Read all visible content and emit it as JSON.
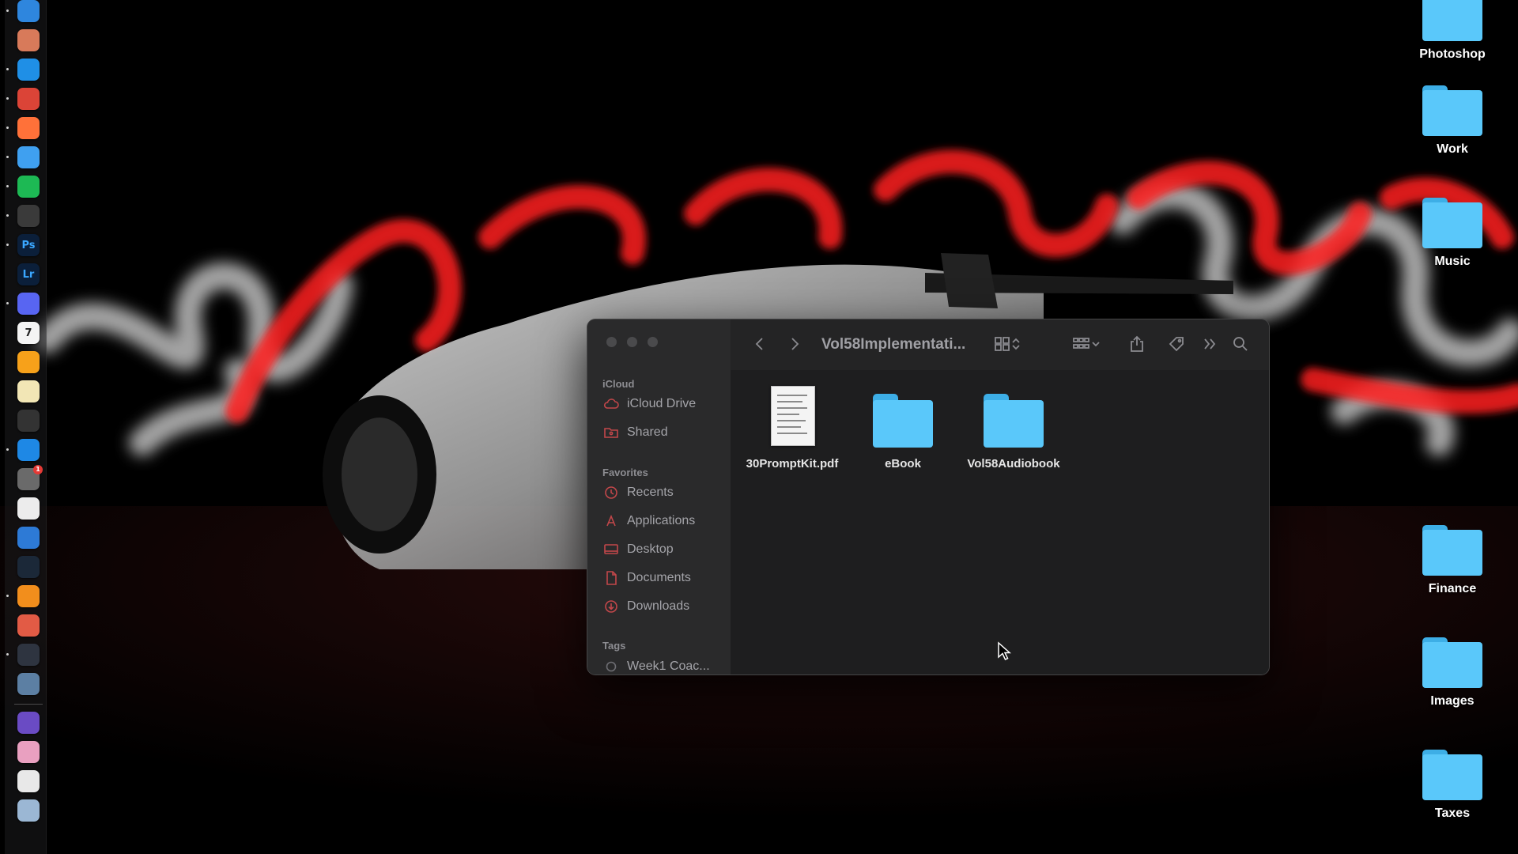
{
  "desktop": {
    "folders": [
      {
        "label": "Photoshop"
      },
      {
        "label": "Work"
      },
      {
        "label": "Music"
      },
      {
        "label": "Finance"
      },
      {
        "label": "Images"
      },
      {
        "label": "Taxes"
      }
    ],
    "folder_color": "#5ac8fa"
  },
  "dock": {
    "apps": [
      {
        "icon": "finder-icon",
        "color": "#2e86de"
      },
      {
        "icon": "launchpad-icon",
        "color": "#d87a5a"
      },
      {
        "icon": "safari-icon",
        "color": "#1f8fe6"
      },
      {
        "icon": "chrome-icon",
        "color": "#db4437"
      },
      {
        "icon": "firefox-icon",
        "color": "#ff7139"
      },
      {
        "icon": "mail-icon",
        "color": "#3fa0f0"
      },
      {
        "icon": "spotify-icon",
        "color": "#1db954"
      },
      {
        "icon": "chatgpt-icon",
        "color": "#3a3a3a"
      },
      {
        "icon": "photoshop-icon",
        "color": "#0b1f3a",
        "glyph": "Ps"
      },
      {
        "icon": "lightroom-icon",
        "color": "#0b1f3a",
        "glyph": "Lr"
      },
      {
        "icon": "discord-icon",
        "color": "#5865f2"
      },
      {
        "icon": "calendar-icon",
        "color": "#f4f4f4",
        "glyph": "7"
      },
      {
        "icon": "pages-icon",
        "color": "#f7a11a"
      },
      {
        "icon": "notes-icon",
        "color": "#f2e6b5"
      },
      {
        "icon": "layers-icon",
        "color": "#333333"
      },
      {
        "icon": "app-store-icon",
        "color": "#1e88e5"
      },
      {
        "icon": "system-settings-icon",
        "color": "#6a6a6a",
        "badge": "1"
      },
      {
        "icon": "textedit-icon",
        "color": "#ececec"
      },
      {
        "icon": "quicktime-icon",
        "color": "#2d7ad6"
      },
      {
        "icon": "steam-icon",
        "color": "#1b2838"
      },
      {
        "icon": "sketch-icon",
        "color": "#f28e1c"
      },
      {
        "icon": "claquette-icon",
        "color": "#e25b45"
      },
      {
        "icon": "time-machine-icon",
        "color": "#2e3440"
      },
      {
        "icon": "preview-icon",
        "color": "#5c7fa3"
      },
      {
        "icon": "imovie-icon",
        "color": "#6a4bc4"
      },
      {
        "icon": "photos-icon",
        "color": "#e9a0c0"
      },
      {
        "icon": "document-icon",
        "color": "#e8e8e8"
      },
      {
        "icon": "downloads-stack-icon",
        "color": "#9bb7d4"
      }
    ]
  },
  "finder": {
    "title": "Vol58Implementati...",
    "sidebar": {
      "icloud_header": "iCloud",
      "icloud_items": [
        {
          "label": "iCloud Drive",
          "icon": "cloud-icon"
        },
        {
          "label": "Shared",
          "icon": "shared-folder-icon"
        }
      ],
      "favorites_header": "Favorites",
      "favorites_items": [
        {
          "label": "Recents",
          "icon": "clock-icon"
        },
        {
          "label": "Applications",
          "icon": "applications-icon"
        },
        {
          "label": "Desktop",
          "icon": "desktop-icon"
        },
        {
          "label": "Documents",
          "icon": "document-icon"
        },
        {
          "label": "Downloads",
          "icon": "download-icon"
        }
      ],
      "tags_header": "Tags",
      "tags_items": [
        {
          "label": "Week1 Coac..."
        }
      ]
    },
    "files": [
      {
        "name": "30PromptKit.pdf",
        "kind": "pdf"
      },
      {
        "name": "eBook",
        "kind": "folder"
      },
      {
        "name": "Vol58Audiobook",
        "kind": "folder"
      }
    ],
    "accent_color": "#c2474a"
  }
}
